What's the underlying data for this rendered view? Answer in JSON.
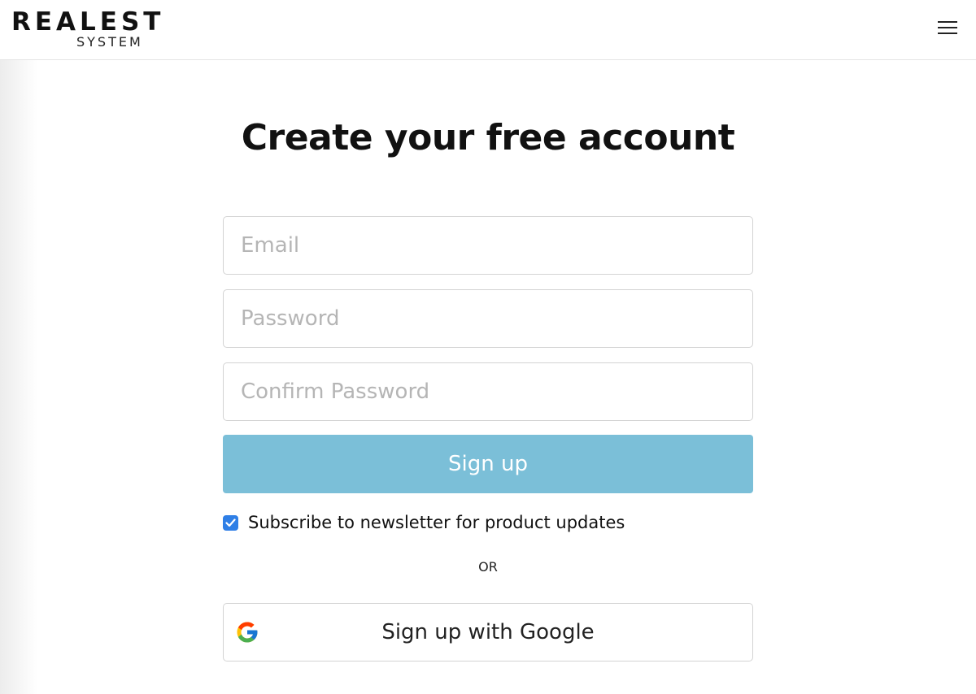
{
  "brand": {
    "name": "REALEST",
    "sub": "SYSTEM"
  },
  "header": {
    "menu_icon": "hamburger-menu-icon"
  },
  "main": {
    "title": "Create your free account",
    "email_placeholder": "Email",
    "password_placeholder": "Password",
    "confirm_placeholder": "Confirm Password",
    "signup_label": "Sign up",
    "newsletter_label": "Subscribe to newsletter for product updates",
    "newsletter_checked": true,
    "or_label": "OR",
    "google_label": "Sign up with Google",
    "google_icon": "google-logo-icon"
  },
  "colors": {
    "signup_button": "#7bbfd8",
    "checkbox": "#2f7fe6"
  }
}
